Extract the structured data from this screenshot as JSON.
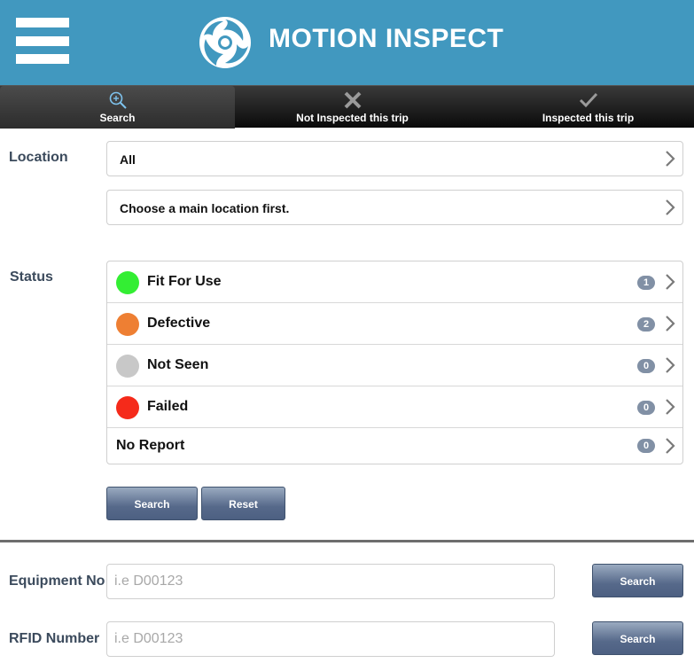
{
  "header": {
    "title": "MOTION INSPECT",
    "menu_icon": "hamburger-menu-icon",
    "logo_icon": "swirl-logo-icon",
    "background_color": "#4198bf"
  },
  "tabs": [
    {
      "label": "Search",
      "icon": "zoom-in-icon",
      "active": true
    },
    {
      "label": "Not Inspected this trip",
      "icon": "x-icon",
      "active": false
    },
    {
      "label": "Inspected this trip",
      "icon": "checkmark-icon",
      "active": false
    }
  ],
  "location": {
    "label": "Location",
    "main_value": "All",
    "sub_value": "Choose a main location first."
  },
  "status": {
    "label": "Status",
    "items": [
      {
        "label": "Fit For Use",
        "count": "1",
        "color": "#33ee33"
      },
      {
        "label": "Defective",
        "count": "2",
        "color": "#ee7f33"
      },
      {
        "label": "Not Seen",
        "count": "0",
        "color": "#c8c8c8"
      },
      {
        "label": "Failed",
        "count": "0",
        "color": "#f52a1a"
      },
      {
        "label": "No Report",
        "count": "0",
        "color": ""
      }
    ]
  },
  "filter_buttons": {
    "search": "Search",
    "reset": "Reset"
  },
  "equipment": {
    "label": "Equipment No",
    "placeholder": "i.e D00123",
    "value": "",
    "button": "Search"
  },
  "rfid": {
    "label": "RFID Number",
    "placeholder": "i.e D00123",
    "value": "",
    "button": "Search"
  }
}
